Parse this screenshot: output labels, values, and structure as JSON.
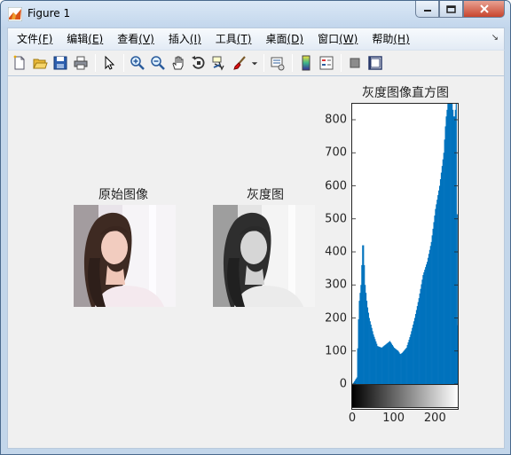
{
  "window": {
    "title": "Figure 1",
    "accent": "#0072bd"
  },
  "menu": {
    "items": [
      {
        "label": "文件",
        "accel": "(F)"
      },
      {
        "label": "编辑",
        "accel": "(E)"
      },
      {
        "label": "查看",
        "accel": "(V)"
      },
      {
        "label": "插入",
        "accel": "(I)"
      },
      {
        "label": "工具",
        "accel": "(T)"
      },
      {
        "label": "桌面",
        "accel": "(D)"
      },
      {
        "label": "窗口",
        "accel": "(W)"
      },
      {
        "label": "帮助",
        "accel": "(H)"
      }
    ]
  },
  "toolbar": {
    "icons": [
      "new-figure-icon",
      "open-file-icon",
      "save-icon",
      "print-icon",
      "select-arrow-icon",
      "zoom-in-icon",
      "zoom-out-icon",
      "pan-hand-icon",
      "rotate-3d-icon",
      "data-cursor-icon",
      "brush-icon",
      "brush-dropdown-icon",
      "link-plot-icon",
      "colorbar-icon",
      "legend-icon",
      "hide-plot-tools-icon",
      "show-plot-tools-icon"
    ]
  },
  "figure": {
    "original_title": "原始图像",
    "gray_title": "灰度图",
    "hist_title": "灰度图像直方图"
  },
  "chart_data": {
    "type": "bar",
    "title": "灰度图像直方图",
    "xlabel": "",
    "ylabel": "",
    "xlim": [
      0,
      255
    ],
    "ylim": [
      0,
      850
    ],
    "xticks": [
      "0",
      "100",
      "200"
    ],
    "yticks": [
      "0",
      "100",
      "200",
      "300",
      "400",
      "500",
      "600",
      "700",
      "800"
    ],
    "series_color": "#0072bd",
    "colorbar": "grayscale 0–255",
    "x": [
      0,
      10,
      15,
      20,
      25,
      30,
      35,
      40,
      50,
      60,
      70,
      80,
      90,
      100,
      110,
      115,
      120,
      130,
      140,
      150,
      160,
      170,
      180,
      190,
      200,
      210,
      220,
      225,
      230,
      235,
      240,
      245,
      250,
      255
    ],
    "values": [
      0,
      20,
      240,
      300,
      450,
      300,
      240,
      200,
      150,
      115,
      110,
      120,
      130,
      110,
      100,
      90,
      95,
      110,
      150,
      200,
      260,
      330,
      370,
      430,
      530,
      600,
      700,
      800,
      850,
      850,
      850,
      800,
      850,
      10
    ]
  }
}
